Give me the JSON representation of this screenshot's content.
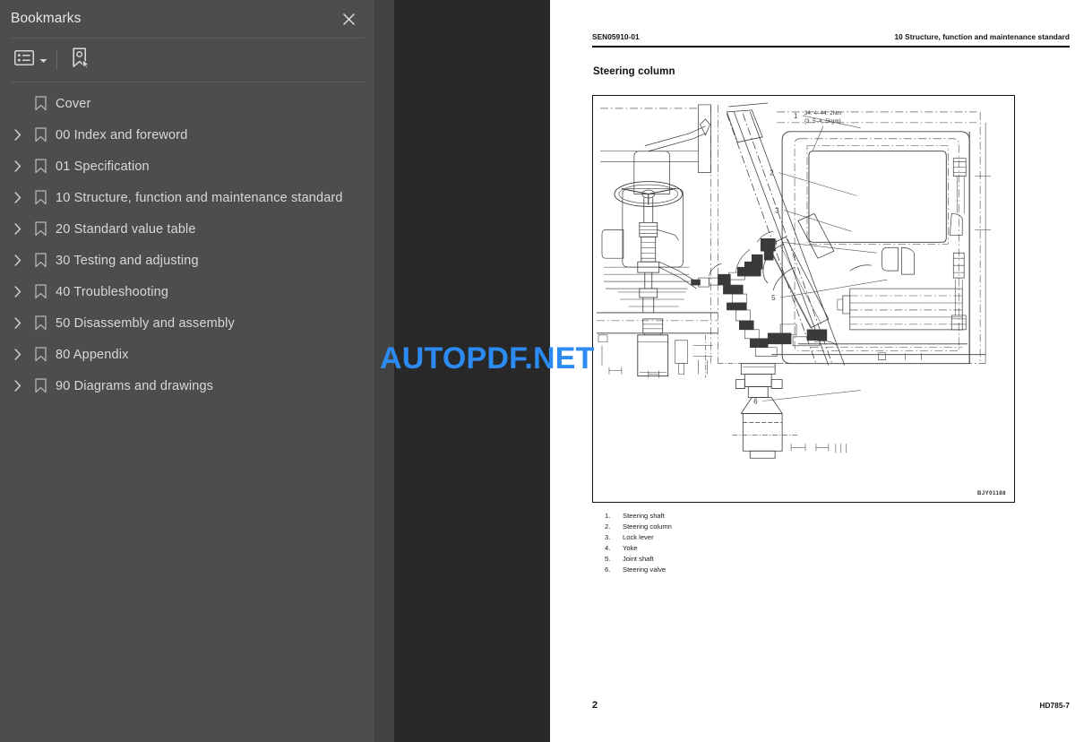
{
  "sidebar": {
    "title": "Bookmarks",
    "close_icon": "close-icon",
    "toolbar": {
      "options_icon": "list-options-icon",
      "options_caret_icon": "chevron-down-icon",
      "new_bookmark_icon": "new-bookmark-icon"
    },
    "items": [
      {
        "label": "Cover",
        "expandable": false
      },
      {
        "label": "00 Index and foreword",
        "expandable": true
      },
      {
        "label": "01 Specification",
        "expandable": true
      },
      {
        "label": "10 Structure, function and maintenance standard",
        "expandable": true
      },
      {
        "label": "20 Standard value table",
        "expandable": true
      },
      {
        "label": "30 Testing and adjusting",
        "expandable": true
      },
      {
        "label": "40 Troubleshooting",
        "expandable": true
      },
      {
        "label": "50 Disassembly and assembly",
        "expandable": true
      },
      {
        "label": "80 Appendix",
        "expandable": true
      },
      {
        "label": "90 Diagrams and drawings",
        "expandable": true
      }
    ]
  },
  "document": {
    "header_left": "SEN05910-01",
    "header_right": "10 Structure, function and maintenance standard",
    "section_title": "Steering column",
    "figure": {
      "torque_note": "34. 4–44. 2Nm\n{3. 5–4. 5kgm}",
      "figure_id": "BJY01188",
      "callouts": [
        "1",
        "2",
        "3",
        "4",
        "5",
        "6"
      ]
    },
    "legend": [
      {
        "num": "1.",
        "text": "Steering shaft"
      },
      {
        "num": "2.",
        "text": "Steering column"
      },
      {
        "num": "3.",
        "text": "Lock lever"
      },
      {
        "num": "4.",
        "text": "Yoke"
      },
      {
        "num": "5.",
        "text": "Joint shaft"
      },
      {
        "num": "6.",
        "text": "Steering valve"
      }
    ],
    "footer_left": "2",
    "footer_right": "HD785-7"
  },
  "watermark": {
    "text": "AUTOPDF.NET",
    "color": "#2b8bf2"
  },
  "colors": {
    "sidebar_bg": "#4d4d4d",
    "gutter_bg": "#424242",
    "viewer_bg": "#282828",
    "page_bg": "#ffffff",
    "text": "#d8d8d8"
  }
}
